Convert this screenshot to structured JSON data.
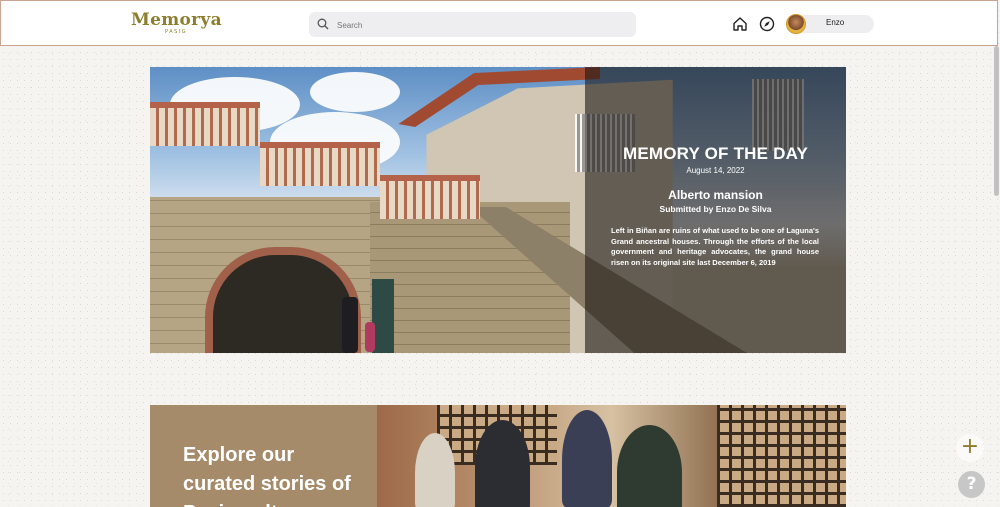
{
  "header": {
    "logo_text": "Memorya",
    "logo_subtext": "PASIG",
    "search_placeholder": "Search",
    "nav_icons": [
      "home-icon",
      "compass-icon"
    ],
    "user_name": "Enzo"
  },
  "hero": {
    "title": "MEMORY OF THE DAY",
    "date": "August 14, 2022",
    "memory_name": "Alberto mansion",
    "submitted_by": "Submitted by Enzo De Silva",
    "description": "Left in Biñan are ruins of what used to be one of Laguna's Grand ancestral houses. Through the efforts of the local government and heritage advocates, the grand house risen on its original site last December 6, 2019"
  },
  "explore": {
    "heading": "Explore our curated stories of Pasig culture",
    "panel_color": "#a58b6a"
  },
  "fabs": {
    "add_label": "+",
    "help_label": "?"
  },
  "colors": {
    "brand": "#8d7e2e",
    "header_border": "#c9a58f"
  }
}
